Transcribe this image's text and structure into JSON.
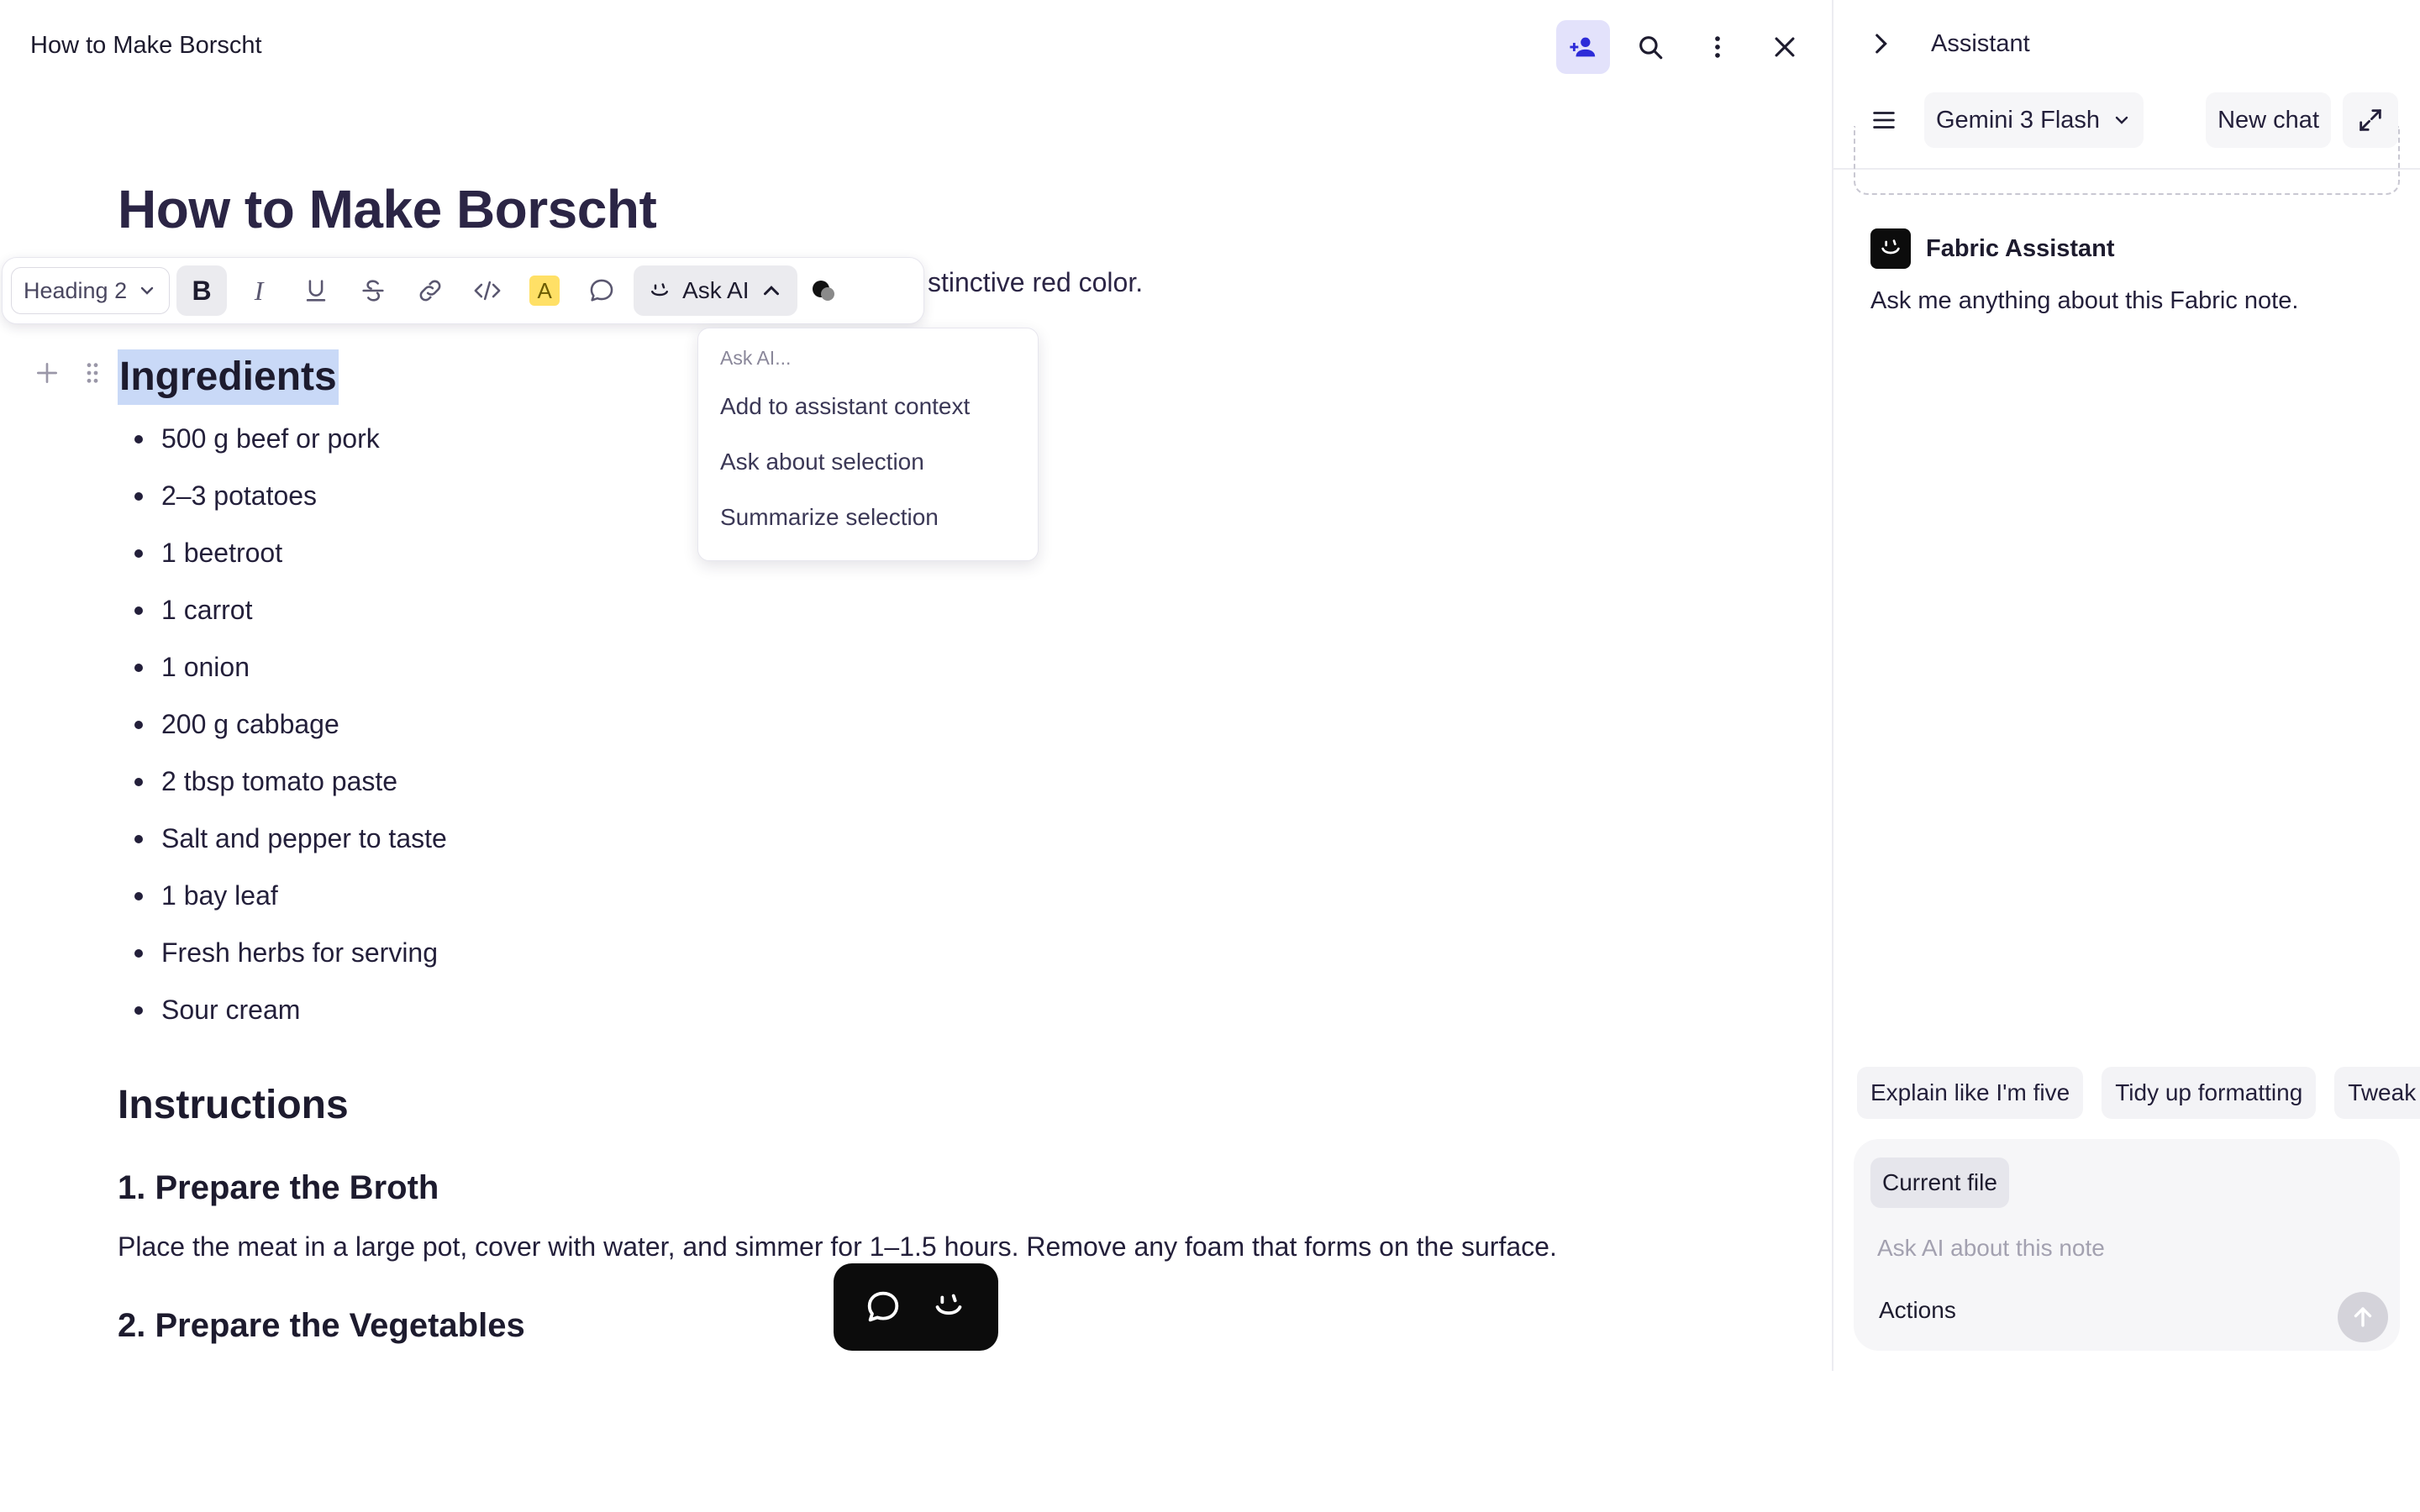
{
  "document": {
    "tab_title": "How to Make Borscht",
    "title": "How to Make Borscht",
    "intro_tail": "stinctive red color.",
    "ingredients_heading": "Ingredients",
    "ingredients": [
      "500 g beef or pork",
      "2–3 potatoes",
      "1 beetroot",
      "1 carrot",
      "1 onion",
      "200 g cabbage",
      "2 tbsp tomato paste",
      "Salt and pepper to taste",
      "1 bay leaf",
      "Fresh herbs for serving",
      "Sour cream"
    ],
    "instructions_heading": "Instructions",
    "step1_heading": "1. Prepare the Broth",
    "step1_text": "Place the meat in a large pot, cover with water, and simmer for 1–1.5 hours. Remove any foam that forms on the surface.",
    "step2_heading": "2. Prepare the Vegetables"
  },
  "top_icons": [
    "add-user-icon",
    "search-icon",
    "more-vertical-icon",
    "close-icon"
  ],
  "toolbar": {
    "block_type": "Heading 2",
    "bold": "B",
    "italic": "I",
    "highlight": "A",
    "ask_ai_label": "Ask AI"
  },
  "ask_ai_menu": {
    "header": "Ask AI...",
    "items": [
      "Add to assistant context",
      "Ask about selection",
      "Summarize selection"
    ]
  },
  "assistant": {
    "title": "Assistant",
    "model": "Gemini 3 Flash",
    "new_chat_label": "New chat",
    "bot_name": "Fabric Assistant",
    "bot_message": "Ask me anything about this Fabric note.",
    "suggestions": [
      "Explain like I'm five",
      "Tidy up formatting",
      "Tweak"
    ],
    "context_chip": "Current file",
    "input_placeholder": "Ask AI about this note",
    "actions_label": "Actions"
  },
  "colors": {
    "accent": "#2d2bd8",
    "accent_bg": "#e3e2fb",
    "selection": "#c9d9f7",
    "highlight_yellow": "#ffe066"
  }
}
